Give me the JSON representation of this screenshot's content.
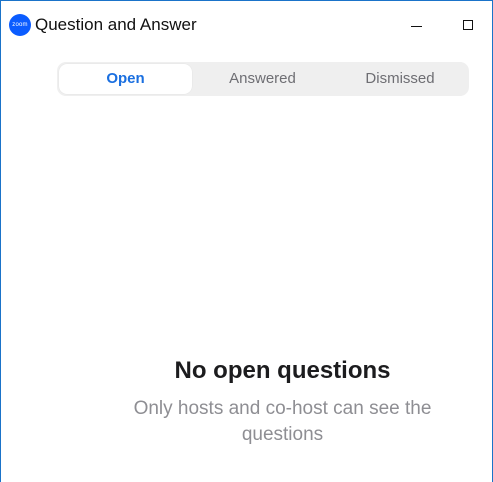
{
  "window": {
    "title": "Question and Answer",
    "logo_text": "zoom",
    "controls": {
      "minimize": "minimize-icon",
      "maximize": "maximize-icon"
    }
  },
  "tabs": [
    {
      "label": "Open",
      "selected": true
    },
    {
      "label": "Answered",
      "selected": false
    },
    {
      "label": "Dismissed",
      "selected": false
    }
  ],
  "empty_state": {
    "title": "No open questions",
    "description": "Only hosts and co-host can see the questions"
  },
  "colors": {
    "accent": "#1a6fe0",
    "logo": "#0b5cff",
    "window_border": "#1a73c9",
    "tab_track": "#efefef",
    "muted_text": "#8e8e93"
  }
}
